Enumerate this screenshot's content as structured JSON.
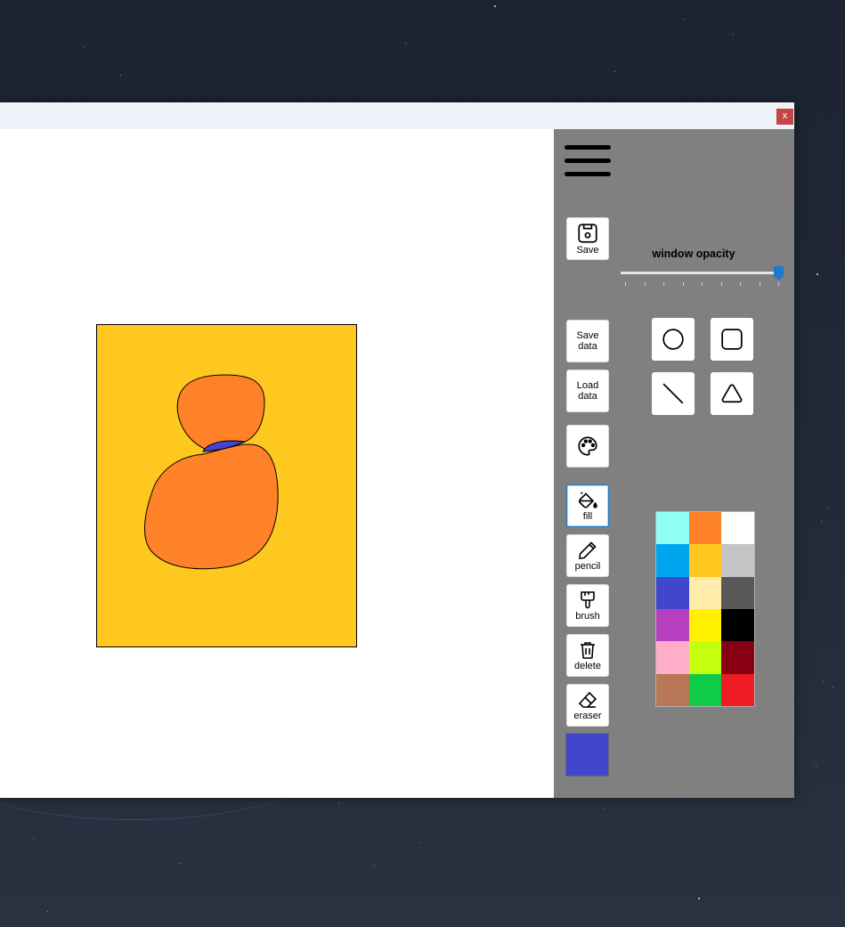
{
  "window": {
    "close_label": "x"
  },
  "toolbar": {
    "save_label": "Save",
    "save_data_label": "Save\ndata",
    "load_data_label": "Load\ndata",
    "fill_label": "fill",
    "pencil_label": "pencil",
    "brush_label": "brush",
    "delete_label": "delete",
    "eraser_label": "eraser",
    "active_tool": "fill"
  },
  "opacity": {
    "label": "window opacity",
    "value_fraction": 1.0
  },
  "shapes": [
    "circle",
    "rounded-square",
    "line",
    "triangle"
  ],
  "palette": {
    "colors": [
      "#8ffff6",
      "#ff8128",
      "#ffffff",
      "#00a5f0",
      "#ffc81e",
      "#c4c4c4",
      "#4046cd",
      "#ffebaa",
      "#585858",
      "#b83ec0",
      "#fff100",
      "#000000",
      "#ffadc8",
      "#c4ff0f",
      "#890015",
      "#b87757",
      "#0ecc48",
      "#ee1c24"
    ]
  },
  "current_color": "#4046cd",
  "drawing": {
    "background": "#ffc81e",
    "shape_color": "#ff8128",
    "fill_color": "#4046cd"
  }
}
